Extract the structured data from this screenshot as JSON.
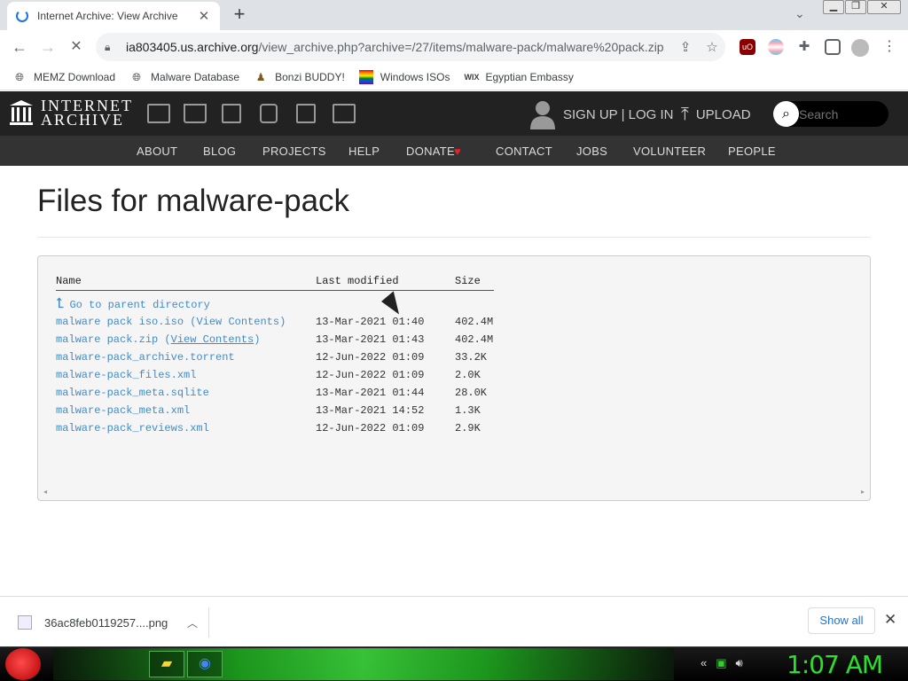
{
  "browser": {
    "tab_title": "Internet Archive: View Archive",
    "url_domain": "ia803405.us.archive.org",
    "url_path": "/view_archive.php?archive=/27/items/malware-pack/malware%20pack.zip"
  },
  "bookmarks": [
    {
      "label": "MEMZ Download",
      "icon": "globe-icon"
    },
    {
      "label": "Malware Database",
      "icon": "globe-icon"
    },
    {
      "label": "Bonzi BUDDY!",
      "icon": "bonzi-icon"
    },
    {
      "label": "Windows ISOs",
      "icon": "windows-flag-icon"
    },
    {
      "label": "Egyptian Embassy",
      "icon": "wix-icon"
    }
  ],
  "ia": {
    "logo_line1": "INTERNET",
    "logo_line2": "ARCHIVE",
    "signup": "SIGN UP | LOG IN",
    "upload": "UPLOAD",
    "search_placeholder": "Search",
    "nav": [
      "ABOUT",
      "BLOG",
      "PROJECTS",
      "HELP",
      "DONATE",
      "CONTACT",
      "JOBS",
      "VOLUNTEER",
      "PEOPLE"
    ]
  },
  "page": {
    "title": "Files for malware-pack",
    "col_name": "Name",
    "col_modified": "Last modified",
    "col_size": "Size",
    "parent_link": "Go to parent directory",
    "files": [
      {
        "name": "malware pack iso.iso",
        "view": "View Contents",
        "modified": "13-Mar-2021 01:40",
        "size": "402.4M"
      },
      {
        "name": "malware pack.zip",
        "view": "View Contents",
        "modified": "13-Mar-2021 01:43",
        "size": "402.4M"
      },
      {
        "name": "malware-pack_archive.torrent",
        "view": "",
        "modified": "12-Jun-2022 01:09",
        "size": "33.2K"
      },
      {
        "name": "malware-pack_files.xml",
        "view": "",
        "modified": "12-Jun-2022 01:09",
        "size": "2.0K"
      },
      {
        "name": "malware-pack_meta.sqlite",
        "view": "",
        "modified": "13-Mar-2021 01:44",
        "size": "28.0K"
      },
      {
        "name": "malware-pack_meta.xml",
        "view": "",
        "modified": "13-Mar-2021 14:52",
        "size": "1.3K"
      },
      {
        "name": "malware-pack_reviews.xml",
        "view": "",
        "modified": "12-Jun-2022 01:09",
        "size": "2.9K"
      }
    ]
  },
  "downloads": {
    "filename": "36ac8feb0119257....png",
    "show_all": "Show all"
  },
  "taskbar": {
    "clock": "1:07 AM"
  },
  "colors": {
    "link": "#428bca",
    "clock": "#2be02b",
    "ia_header": "#222222"
  }
}
